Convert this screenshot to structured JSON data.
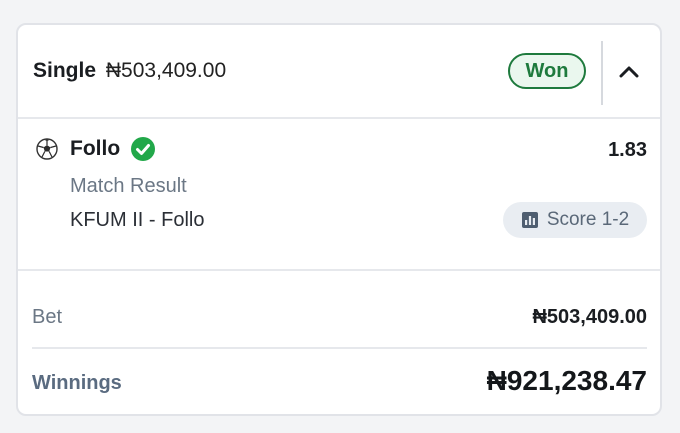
{
  "header": {
    "bet_type": "Single",
    "stake_display": "₦503,409.00",
    "status": "Won",
    "status_color": "#1e7a3d"
  },
  "selection": {
    "sport_icon": "soccer-ball-icon",
    "team": "Follo",
    "result_icon": "check-circle-icon",
    "odds": "1.83",
    "market": "Match Result",
    "fixture": "KFUM II - Follo",
    "score_label": "Score 1-2"
  },
  "summary": {
    "bet_label": "Bet",
    "bet_amount": "₦503,409.00",
    "winnings_label": "Winnings",
    "winnings_amount": "₦921,238.47"
  }
}
